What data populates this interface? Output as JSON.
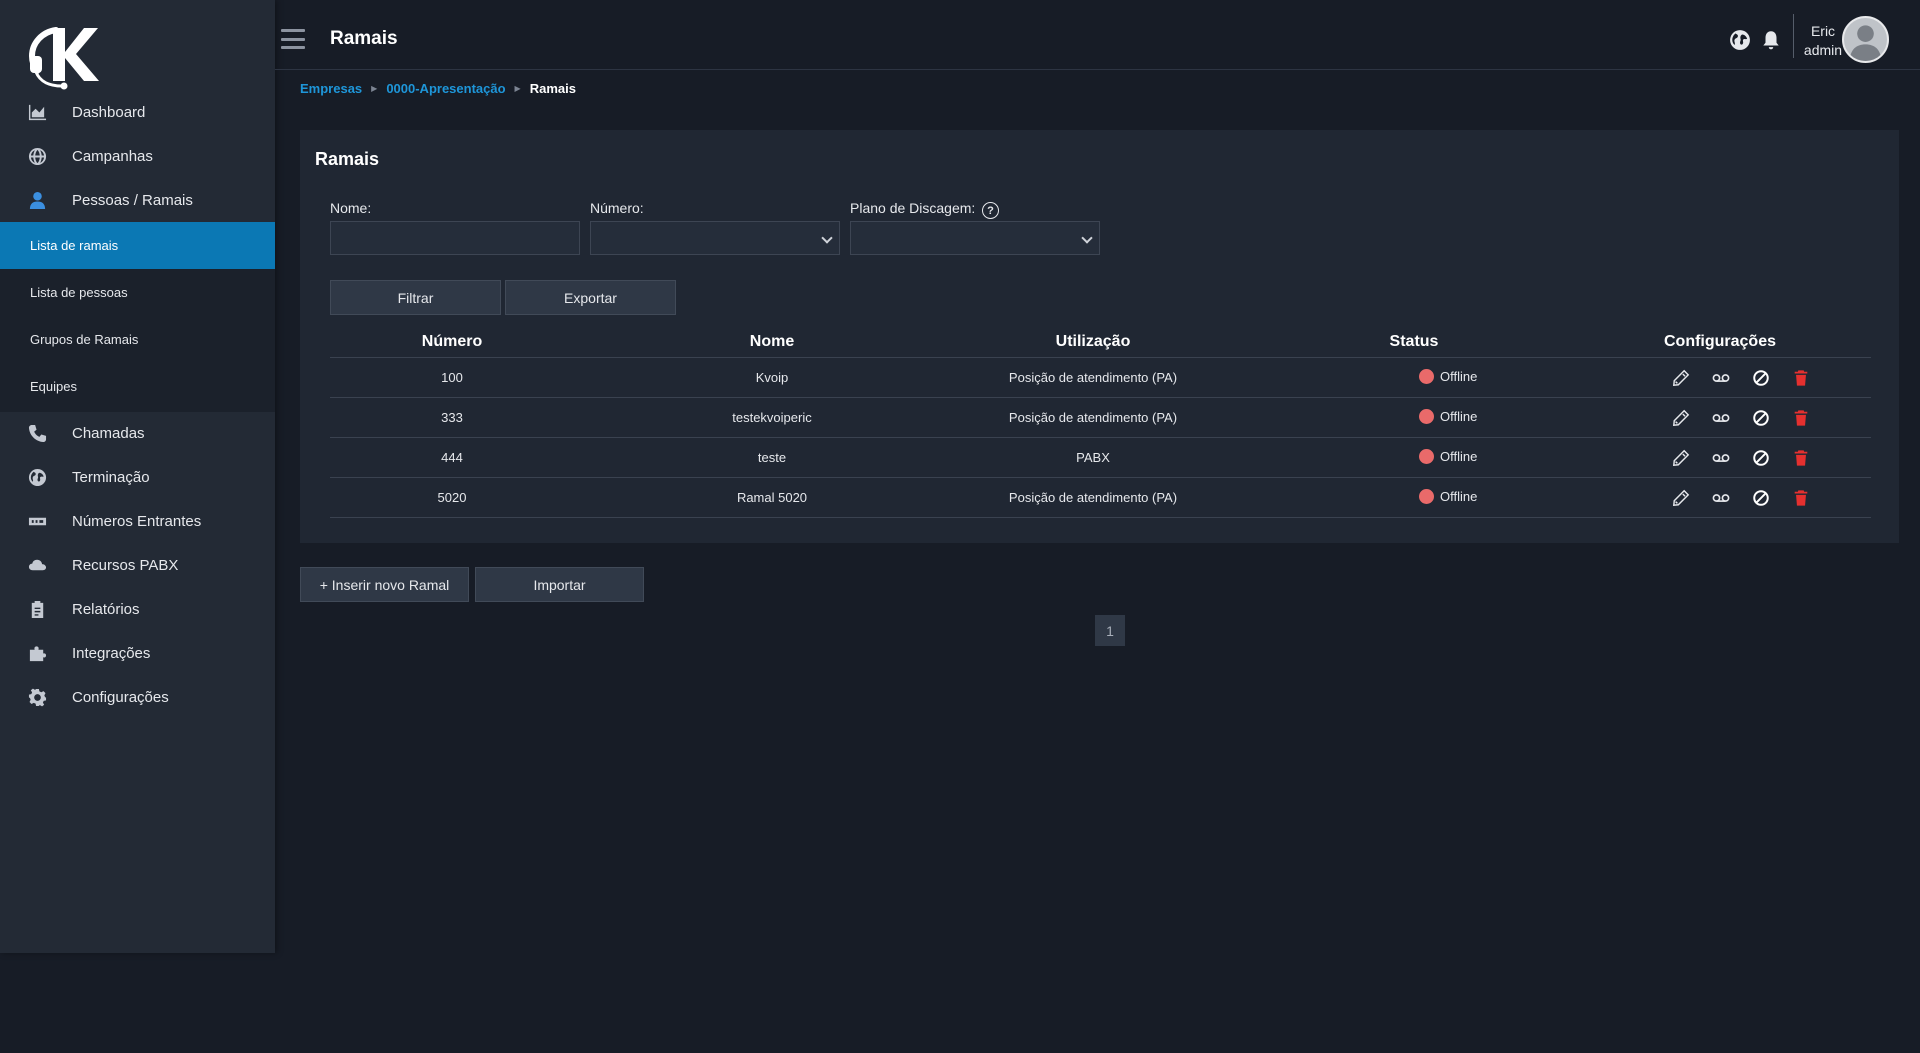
{
  "brand": {
    "logo_letter": "K",
    "accent": "#0b78b4",
    "link_color": "#1e96d9",
    "offline_color": "#e96a6a"
  },
  "sidebar": {
    "items": [
      {
        "label": "Dashboard",
        "icon": "chart-area-icon"
      },
      {
        "label": "Campanhas",
        "icon": "globe-icon"
      },
      {
        "label": "Pessoas / Ramais",
        "icon": "user-icon"
      },
      {
        "label": "Chamadas",
        "icon": "phone-icon"
      },
      {
        "label": "Terminação",
        "icon": "globe-americas-icon"
      },
      {
        "label": "Números Entrantes",
        "icon": "sim-card-icon"
      },
      {
        "label": "Recursos PABX",
        "icon": "cloud-icon"
      },
      {
        "label": "Relatórios",
        "icon": "clipboard-icon"
      },
      {
        "label": "Integrações",
        "icon": "puzzle-icon"
      },
      {
        "label": "Configurações",
        "icon": "gear-icon"
      }
    ],
    "submenu": [
      {
        "label": "Lista de ramais",
        "active": true
      },
      {
        "label": "Lista de pessoas"
      },
      {
        "label": "Grupos de Ramais"
      },
      {
        "label": "Equipes"
      }
    ]
  },
  "header": {
    "title": "Ramais",
    "user": {
      "name": "Eric",
      "role": "admin"
    }
  },
  "breadcrumb": {
    "items": [
      "Empresas",
      "0000-Apresentação"
    ],
    "current": "Ramais"
  },
  "card": {
    "title": "Ramais",
    "filters": {
      "nome_label": "Nome:",
      "nome_value": "",
      "numero_label": "Número:",
      "numero_value": "",
      "plano_label": "Plano de Discagem:",
      "plano_value": "",
      "help_glyph": "?"
    },
    "buttons": {
      "filter": "Filtrar",
      "export": "Exportar"
    },
    "table": {
      "headers": [
        "Número",
        "Nome",
        "Utilização",
        "Status",
        "Configurações"
      ],
      "rows": [
        {
          "numero": "100",
          "nome": "Kvoip",
          "utilizacao": "Posição de atendimento (PA)",
          "status": "Offline"
        },
        {
          "numero": "333",
          "nome": "testekvoiperic",
          "utilizacao": "Posição de atendimento (PA)",
          "status": "Offline"
        },
        {
          "numero": "444",
          "nome": "teste",
          "utilizacao": "PABX",
          "status": "Offline"
        },
        {
          "numero": "5020",
          "nome": "Ramal 5020",
          "utilizacao": "Posição de atendimento (PA)",
          "status": "Offline"
        }
      ]
    }
  },
  "actions": {
    "insert": "+ Inserir novo Ramal",
    "import": "Importar"
  },
  "pagination": {
    "current": "1"
  }
}
